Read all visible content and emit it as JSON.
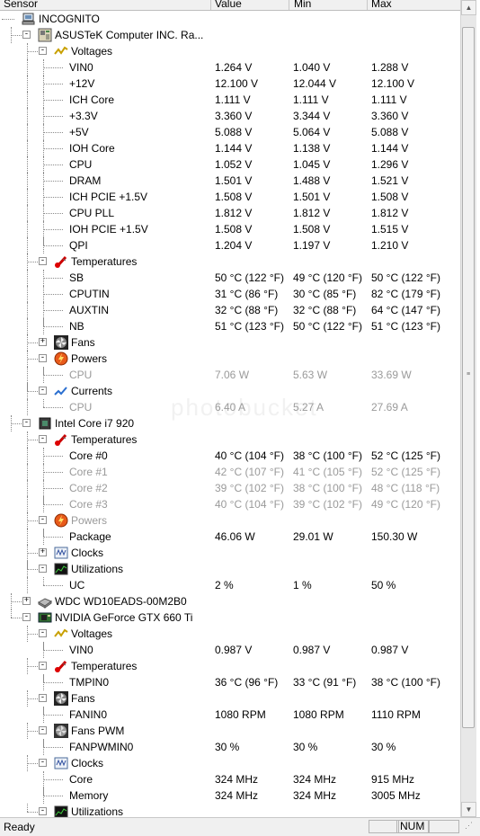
{
  "columns": {
    "sensor": "Sensor",
    "value": "Value",
    "min": "Min",
    "max": "Max"
  },
  "colors": {
    "header_bg": "#f0f0f0",
    "faded_text": "#9a9a9a",
    "status_bg": "#f0f0f0"
  },
  "rows": [
    {
      "level": 0,
      "exp": "-",
      "icon": "computer-icon",
      "label": "INCOGNITO"
    },
    {
      "level": 1,
      "exp": "-",
      "icon": "motherboard-icon",
      "label": "ASUSTeK Computer INC. Ra..."
    },
    {
      "level": 2,
      "exp": "-",
      "icon": "voltage-icon",
      "label": "Voltages"
    },
    {
      "level": 3,
      "label": "VIN0",
      "v": "1.264 V",
      "min": "1.040 V",
      "max": "1.288 V"
    },
    {
      "level": 3,
      "label": "+12V",
      "v": "12.100 V",
      "min": "12.044 V",
      "max": "12.100 V"
    },
    {
      "level": 3,
      "label": "ICH Core",
      "v": "1.111 V",
      "min": "1.111 V",
      "max": "1.111 V"
    },
    {
      "level": 3,
      "label": "+3.3V",
      "v": "3.360 V",
      "min": "3.344 V",
      "max": "3.360 V"
    },
    {
      "level": 3,
      "label": "+5V",
      "v": "5.088 V",
      "min": "5.064 V",
      "max": "5.088 V"
    },
    {
      "level": 3,
      "label": "IOH Core",
      "v": "1.144 V",
      "min": "1.138 V",
      "max": "1.144 V"
    },
    {
      "level": 3,
      "label": "CPU",
      "v": "1.052 V",
      "min": "1.045 V",
      "max": "1.296 V"
    },
    {
      "level": 3,
      "label": "DRAM",
      "v": "1.501 V",
      "min": "1.488 V",
      "max": "1.521 V"
    },
    {
      "level": 3,
      "label": "ICH PCIE +1.5V",
      "v": "1.508 V",
      "min": "1.501 V",
      "max": "1.508 V"
    },
    {
      "level": 3,
      "label": "CPU PLL",
      "v": "1.812 V",
      "min": "1.812 V",
      "max": "1.812 V"
    },
    {
      "level": 3,
      "label": "IOH PCIE +1.5V",
      "v": "1.508 V",
      "min": "1.508 V",
      "max": "1.515 V"
    },
    {
      "level": 3,
      "label": "QPI",
      "v": "1.204 V",
      "min": "1.197 V",
      "max": "1.210 V",
      "last": true
    },
    {
      "level": 2,
      "exp": "-",
      "icon": "thermometer-icon",
      "label": "Temperatures"
    },
    {
      "level": 3,
      "label": "SB",
      "v": "50 °C  (122 °F)",
      "min": "49 °C  (120 °F)",
      "max": "50 °C  (122 °F)"
    },
    {
      "level": 3,
      "label": "CPUTIN",
      "v": "31 °C  (86 °F)",
      "min": "30 °C  (85 °F)",
      "max": "82 °C  (179 °F)"
    },
    {
      "level": 3,
      "label": "AUXTIN",
      "v": "32 °C  (88 °F)",
      "min": "32 °C  (88 °F)",
      "max": "64 °C  (147 °F)"
    },
    {
      "level": 3,
      "label": "NB",
      "v": "51 °C  (123 °F)",
      "min": "50 °C  (122 °F)",
      "max": "51 °C  (123 °F)",
      "last": true
    },
    {
      "level": 2,
      "exp": "+",
      "icon": "fan-icon",
      "label": "Fans"
    },
    {
      "level": 2,
      "exp": "-",
      "icon": "power-icon",
      "label": "Powers"
    },
    {
      "level": 3,
      "label": "CPU",
      "v": "7.06 W",
      "min": "5.63 W",
      "max": "33.69 W",
      "faded": true,
      "last": true
    },
    {
      "level": 2,
      "exp": "-",
      "icon": "current-icon",
      "label": "Currents",
      "lastChild": true
    },
    {
      "level": 3,
      "label": "CPU",
      "v": "6.40 A",
      "min": "5.27 A",
      "max": "27.69 A",
      "faded": true,
      "last": true
    },
    {
      "level": 1,
      "exp": "-",
      "icon": "cpu-chip-icon",
      "label": "Intel Core i7 920"
    },
    {
      "level": 2,
      "exp": "-",
      "icon": "thermometer-icon",
      "label": "Temperatures"
    },
    {
      "level": 3,
      "label": "Core #0",
      "v": "40 °C  (104 °F)",
      "min": "38 °C  (100 °F)",
      "max": "52 °C  (125 °F)"
    },
    {
      "level": 3,
      "label": "Core #1",
      "v": "42 °C  (107 °F)",
      "min": "41 °C  (105 °F)",
      "max": "52 °C  (125 °F)",
      "faded": true
    },
    {
      "level": 3,
      "label": "Core #2",
      "v": "39 °C  (102 °F)",
      "min": "38 °C  (100 °F)",
      "max": "48 °C  (118 °F)",
      "faded": true
    },
    {
      "level": 3,
      "label": "Core #3",
      "v": "40 °C  (104 °F)",
      "min": "39 °C  (102 °F)",
      "max": "49 °C  (120 °F)",
      "faded": true,
      "last": true
    },
    {
      "level": 2,
      "exp": "-",
      "icon": "power-icon",
      "label": "Powers",
      "faded": true
    },
    {
      "level": 3,
      "label": "Package",
      "v": "46.06 W",
      "min": "29.01 W",
      "max": "150.30 W",
      "last": true
    },
    {
      "level": 2,
      "exp": "+",
      "icon": "clock-icon",
      "label": "Clocks"
    },
    {
      "level": 2,
      "exp": "-",
      "icon": "utilization-icon",
      "label": "Utilizations",
      "lastChild": true
    },
    {
      "level": 3,
      "label": "UC",
      "v": "2 %",
      "min": "1 %",
      "max": "50 %",
      "last": true
    },
    {
      "level": 1,
      "exp": "+",
      "icon": "hard-drive-icon",
      "label": "WDC WD10EADS-00M2B0"
    },
    {
      "level": 1,
      "exp": "-",
      "icon": "gpu-icon",
      "label": "NVIDIA GeForce GTX 660 Ti",
      "lastChild": true
    },
    {
      "level": 2,
      "exp": "-",
      "icon": "voltage-icon",
      "label": "Voltages"
    },
    {
      "level": 3,
      "label": "VIN0",
      "v": "0.987 V",
      "min": "0.987 V",
      "max": "0.987 V",
      "last": true
    },
    {
      "level": 2,
      "exp": "-",
      "icon": "thermometer-icon",
      "label": "Temperatures"
    },
    {
      "level": 3,
      "label": "TMPIN0",
      "v": "36 °C  (96 °F)",
      "min": "33 °C  (91 °F)",
      "max": "38 °C  (100 °F)",
      "last": true
    },
    {
      "level": 2,
      "exp": "-",
      "icon": "fan-icon",
      "label": "Fans"
    },
    {
      "level": 3,
      "label": "FANIN0",
      "v": "1080 RPM",
      "min": "1080 RPM",
      "max": "1110 RPM",
      "last": true
    },
    {
      "level": 2,
      "exp": "-",
      "icon": "fan-pwm-icon",
      "label": "Fans PWM"
    },
    {
      "level": 3,
      "label": "FANPWMIN0",
      "v": "30 %",
      "min": "30 %",
      "max": "30 %",
      "last": true
    },
    {
      "level": 2,
      "exp": "-",
      "icon": "clock-icon",
      "label": "Clocks"
    },
    {
      "level": 3,
      "label": "Core",
      "v": "324 MHz",
      "min": "324 MHz",
      "max": "915 MHz"
    },
    {
      "level": 3,
      "label": "Memory",
      "v": "324 MHz",
      "min": "324 MHz",
      "max": "3005 MHz",
      "last": true
    },
    {
      "level": 2,
      "exp": "-",
      "icon": "utilization-icon",
      "label": "Utilizations",
      "lastChild": true
    }
  ],
  "status": {
    "text": "Ready",
    "num": "NUM"
  },
  "watermark": "photobucket"
}
